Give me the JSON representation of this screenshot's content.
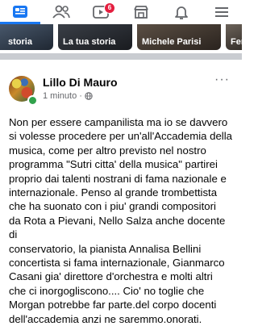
{
  "nav": {
    "items": [
      {
        "id": "home",
        "active": true
      },
      {
        "id": "friends",
        "active": false
      },
      {
        "id": "watch",
        "active": false,
        "badge": "6"
      },
      {
        "id": "marketplace",
        "active": false
      },
      {
        "id": "notifications",
        "active": false
      },
      {
        "id": "menu",
        "active": false
      }
    ],
    "accent_color": "#1877f2"
  },
  "stories": [
    {
      "label": "storia"
    },
    {
      "label": "La tua storia"
    },
    {
      "label": "Michele Parisi"
    },
    {
      "label": "Fer"
    }
  ],
  "post": {
    "author": "Lillo Di Mauro",
    "time": "1 minuto",
    "separator": "·",
    "privacy_icon": "globe-icon",
    "more_label": "···",
    "text": "Non per essere campanilista ma io se davvero\nsi volesse procedere per un'all'Accademia della\nmusica, come per altro previsto nel nostro\nprogramma \"Sutri citta' della musica\" partirei\nproprio dai talenti nostrani di fama nazionale e\ninternazionale. Penso al grande trombettista\nche ha suonato con i piu' grandi compositori\nda Rota a Pievani, Nello Salza anche docente di\nconservatorio, la pianista Annalisa Bellini\nconcertista si fama internazionale, Gianmarco\nCasani gia' direttore d'orchestra e molti altri\nche ci inorgogliscono.... Cio' no  toglie che\nMorgan potrebbe far parte.del corpo docenti\ndell'accademia anzi ne saremmo.onorati."
  }
}
